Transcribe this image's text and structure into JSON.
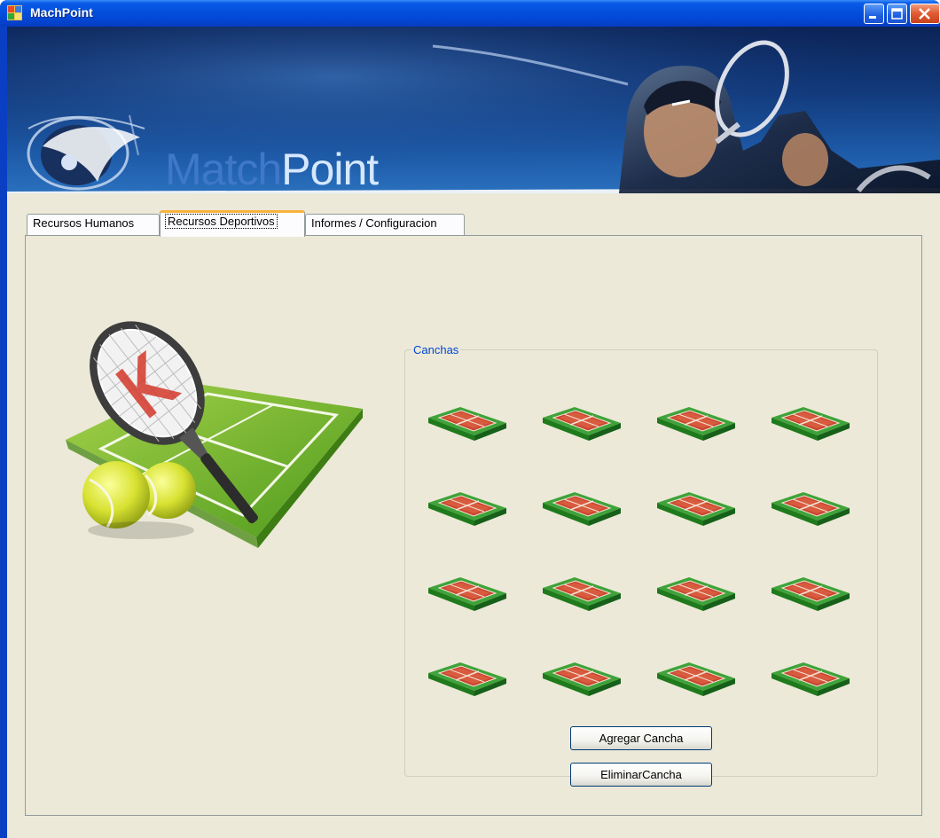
{
  "window": {
    "title": "MachPoint",
    "brand_color": "#0a3fc4"
  },
  "banner": {
    "logo_part1": "Match",
    "logo_part2": "Point"
  },
  "tabs": [
    {
      "label": "Recursos Humanos",
      "active": false
    },
    {
      "label": "Recursos Deportivos",
      "active": true
    },
    {
      "label": "Informes / Configuracion",
      "active": false
    }
  ],
  "courts_group": {
    "title": "Canchas",
    "court_icon": "tennis-court-icon",
    "court_count": 16,
    "add_button": "Agregar Cancha",
    "remove_button": "EliminarCancha"
  }
}
